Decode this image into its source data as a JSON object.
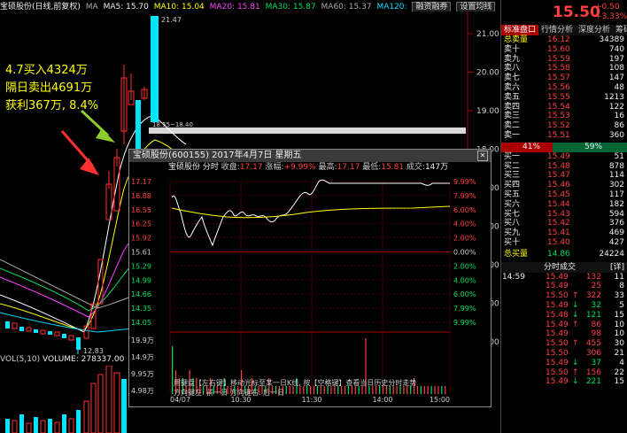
{
  "topbar": {
    "title": "宝硕股份(日线,前复权)",
    "ma": "MA",
    "ma5": "MA5: 15.70",
    "ma10": "MA10: 15.04",
    "ma20": "MA20: 15.81",
    "ma30": "MA30: 15.87",
    "ma60": "MA60: 15.37",
    "ma120": "MA120:",
    "btn_margin": "融资融券",
    "btn_settings": "设置均线"
  },
  "chart": {
    "y_labels": [
      "21.00",
      "20.00",
      "19.00",
      "18.00",
      "17.00",
      "16.00",
      "15.00",
      "14.00",
      "13.00"
    ],
    "high_label": "21.47",
    "low_label": "12.83",
    "range_label": "18.55~18.40",
    "annotation_lines": [
      "4.7买入4324万",
      "隔日卖出4691万",
      "获利367万, 8.4%"
    ],
    "volume_label": "VOL(5,10)",
    "volume_value": "VOLUME: 278337.00"
  },
  "popup": {
    "title": "宝硕股份(600155) 2017年4月7日 星期五",
    "header_name": "宝硕股份",
    "header_mode": "分时",
    "close_label": "收盘:",
    "close_value": "17.17",
    "change_label": "涨幅:",
    "change_value": "+9.99%",
    "high_label": "最高:",
    "high_value": "17.17",
    "low_label": "最低:",
    "low_value": "15.81",
    "vol_label": "成交:",
    "vol_value": "147万",
    "left_axis": [
      "17.17",
      "16.88",
      "16.55",
      "16.25",
      "15.92",
      "15.61",
      "15.29",
      "14.99",
      "14.66",
      "14.35",
      "14.05"
    ],
    "right_axis": [
      "9.99%",
      "7.99%",
      "6.00%",
      "4.00%",
      "2.00%",
      "0.00%",
      "2.00%",
      "4.00%",
      "6.00%",
      "7.99%",
      "9.99%"
    ],
    "vol_axis": [
      "19.9万",
      "14.9万",
      "9.95万",
      "4.98万"
    ],
    "time_labels": [
      "04/07",
      "10:30",
      "11:30",
      "14:00",
      "15:00"
    ],
    "hint1": "用键盘【左右键】移动光标至某一日K线, 按【空格键】查看当日历史分时走势",
    "hint2": "方向键左: 前一日    方向键右: 后一日",
    "volumes": [
      6,
      3,
      2,
      2,
      1,
      3,
      2,
      2,
      1,
      1,
      1,
      2,
      1,
      1,
      1,
      2,
      1,
      1,
      1,
      1,
      3,
      1,
      1,
      2,
      1,
      1,
      1,
      1,
      2,
      1,
      1,
      1,
      1,
      1,
      1,
      1,
      2,
      1,
      1,
      1,
      1,
      1,
      1,
      1,
      1,
      1,
      1,
      1,
      1,
      1,
      1,
      1,
      1,
      1,
      1,
      1,
      7,
      1,
      1,
      1,
      1,
      1,
      1,
      1,
      1,
      1,
      1,
      1,
      1,
      1,
      2,
      1,
      1,
      1,
      1,
      1,
      1,
      1,
      1,
      1
    ]
  },
  "right_panel": {
    "price": "15.50",
    "change": "+0.50",
    "change_pct": "+3.33%",
    "tabs": [
      "标准盘口",
      "行情分析",
      "深度分析",
      "筹码"
    ],
    "total_sell_label": "总卖量",
    "total_sell_price": "16.12",
    "total_sell_vol": "34389",
    "asks": [
      {
        "label": "卖十",
        "price": "15.60",
        "vol": "740"
      },
      {
        "label": "卖九",
        "price": "15.59",
        "vol": "197"
      },
      {
        "label": "卖八",
        "price": "15.58",
        "vol": "108"
      },
      {
        "label": "卖七",
        "price": "15.57",
        "vol": "147"
      },
      {
        "label": "卖六",
        "price": "15.56",
        "vol": "48"
      },
      {
        "label": "卖五",
        "price": "15.55",
        "vol": "1213"
      },
      {
        "label": "卖四",
        "price": "15.54",
        "vol": "122"
      },
      {
        "label": "卖三",
        "price": "15.53",
        "vol": "16"
      },
      {
        "label": "卖二",
        "price": "15.52",
        "vol": "86"
      },
      {
        "label": "卖一",
        "price": "15.51",
        "vol": "360"
      }
    ],
    "bar_left": "41%",
    "bar_right": "59%",
    "bids": [
      {
        "label": "买一",
        "price": "15.49",
        "vol": "51"
      },
      {
        "label": "买二",
        "price": "15.48",
        "vol": "878"
      },
      {
        "label": "买三",
        "price": "15.47",
        "vol": "114"
      },
      {
        "label": "买四",
        "price": "15.46",
        "vol": "302"
      },
      {
        "label": "买五",
        "price": "15.45",
        "vol": "117"
      },
      {
        "label": "买六",
        "price": "15.44",
        "vol": "182"
      },
      {
        "label": "买七",
        "price": "15.43",
        "vol": "594"
      },
      {
        "label": "买八",
        "price": "15.42",
        "vol": "376"
      },
      {
        "label": "买九",
        "price": "15.41",
        "vol": "469"
      },
      {
        "label": "买十",
        "price": "15.40",
        "vol": "427"
      }
    ],
    "total_buy_label": "总买量",
    "total_buy_price": "14.86",
    "total_buy_vol": "24224",
    "trades_title": "分时成交",
    "trades_detail": "[详]",
    "trades": [
      {
        "time": "14:59",
        "price": "15.49",
        "arrow": "",
        "vol": "132",
        "count": "11"
      },
      {
        "time": "",
        "price": "15.49",
        "arrow": "",
        "vol": "25",
        "count": "8"
      },
      {
        "time": "",
        "price": "15.50",
        "arrow": "↑",
        "vol": "322",
        "count": "33"
      },
      {
        "time": "",
        "price": "15.49",
        "arrow": "↓",
        "vol": "32",
        "count": "5"
      },
      {
        "time": "",
        "price": "15.48",
        "arrow": "↓",
        "vol": "121",
        "count": "15"
      },
      {
        "time": "",
        "price": "15.49",
        "arrow": "↑",
        "vol": "86",
        "count": "10"
      },
      {
        "time": "",
        "price": "15.49",
        "arrow": "",
        "vol": "98",
        "count": "10"
      },
      {
        "time": "",
        "price": "15.50",
        "arrow": "↑",
        "vol": "455",
        "count": "30"
      },
      {
        "time": "",
        "price": "15.50",
        "arrow": "",
        "vol": "306",
        "count": "21"
      },
      {
        "time": "",
        "price": "15.49",
        "arrow": "↓",
        "vol": "37",
        "count": "4"
      },
      {
        "time": "",
        "price": "15.50",
        "arrow": "↑",
        "vol": "156",
        "count": "22"
      },
      {
        "time": "",
        "price": "15.49",
        "arrow": "↓",
        "vol": "221",
        "count": "15"
      }
    ]
  },
  "colors": {
    "up": "#ff4040",
    "down": "#00e060",
    "accent": "#ffff00",
    "cyan": "#00d8ff"
  }
}
